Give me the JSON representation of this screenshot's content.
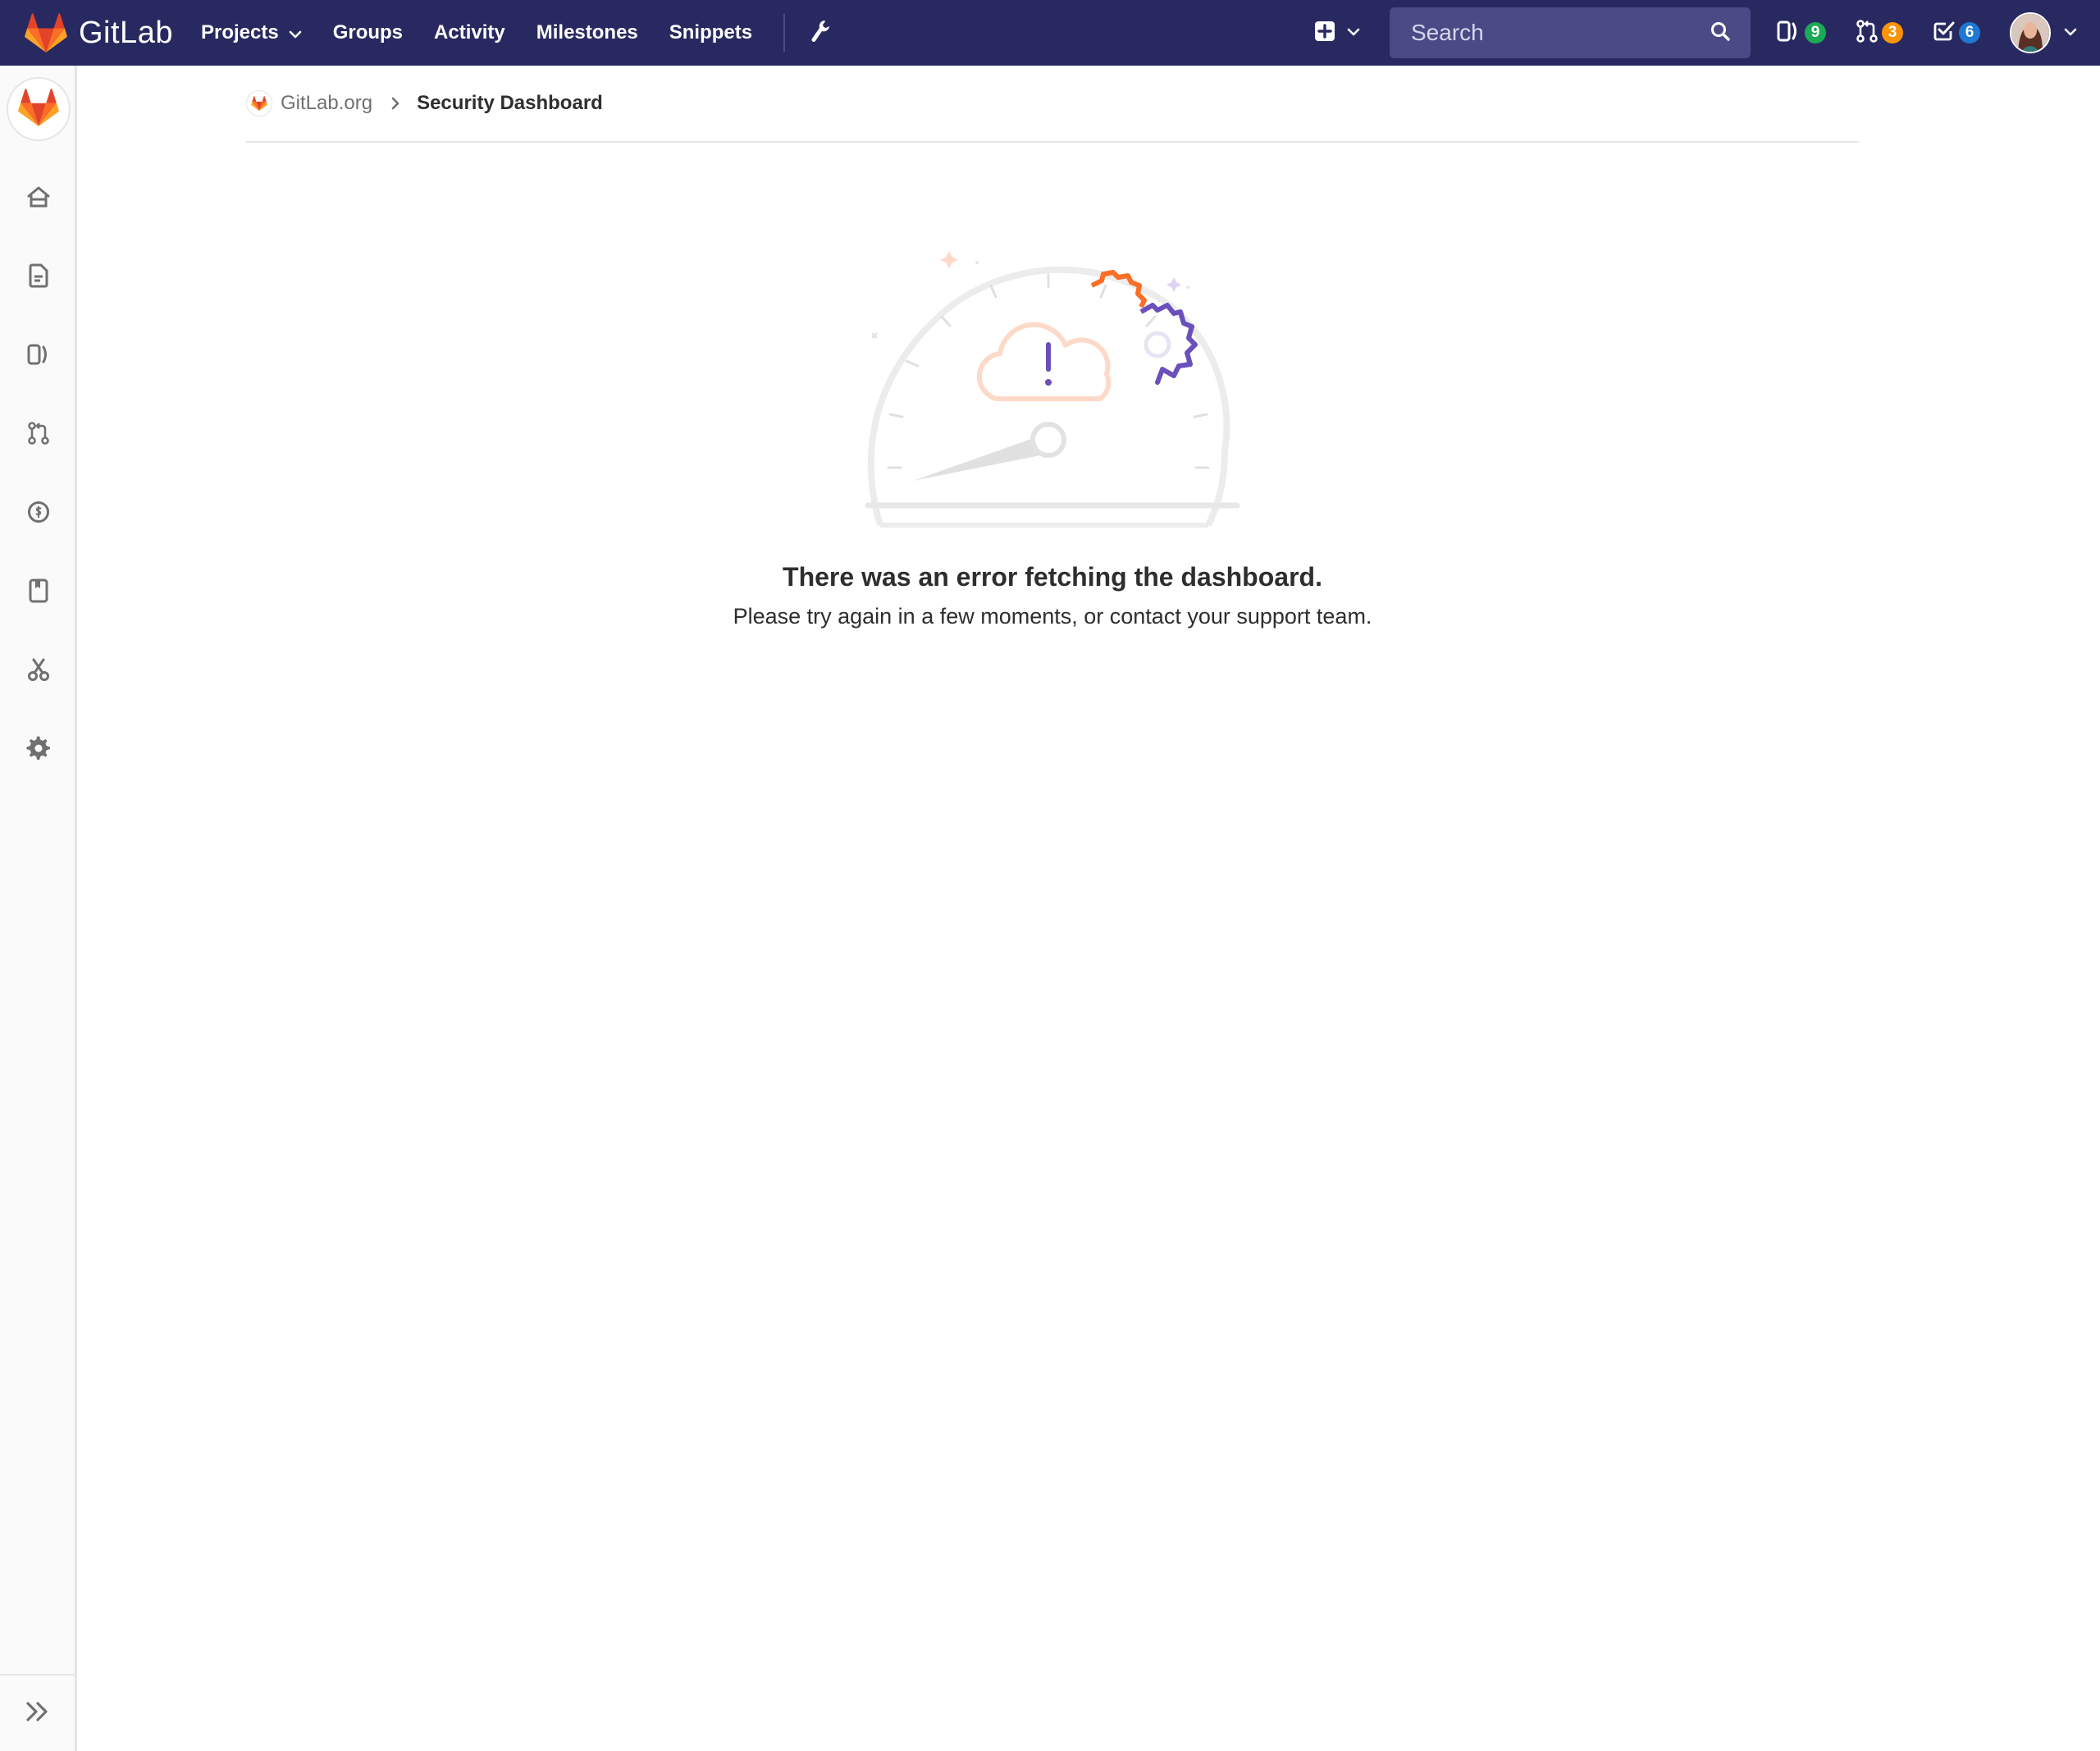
{
  "app": {
    "brand_name": "GitLab"
  },
  "navbar": {
    "links": [
      {
        "label": "Projects",
        "has_dropdown": true
      },
      {
        "label": "Groups"
      },
      {
        "label": "Activity"
      },
      {
        "label": "Milestones"
      },
      {
        "label": "Snippets"
      }
    ],
    "search": {
      "placeholder": "Search"
    },
    "counters": {
      "issues": {
        "count": "9",
        "color": "#1aaa55"
      },
      "merge_requests": {
        "count": "3",
        "color": "#fc9403"
      },
      "todos": {
        "count": "6",
        "color": "#1f78d1"
      }
    }
  },
  "sidebar": {
    "items": [
      "home-icon",
      "file-icon",
      "issues-icon",
      "merge-request-icon",
      "cost-icon",
      "wiki-icon",
      "scissors-icon",
      "settings-icon"
    ],
    "collapse_icon": "double-chevron-right-icon"
  },
  "breadcrumbs": {
    "root": "GitLab.org",
    "current": "Security Dashboard"
  },
  "empty_state": {
    "title": "There was an error fetching the dashboard.",
    "description": "Please try again in a few moments, or contact your support team."
  },
  "colors": {
    "navbar_bg": "#292961",
    "search_bg": "#4a4a86",
    "orange": "#fc6d26",
    "purple": "#6b4fbb"
  }
}
